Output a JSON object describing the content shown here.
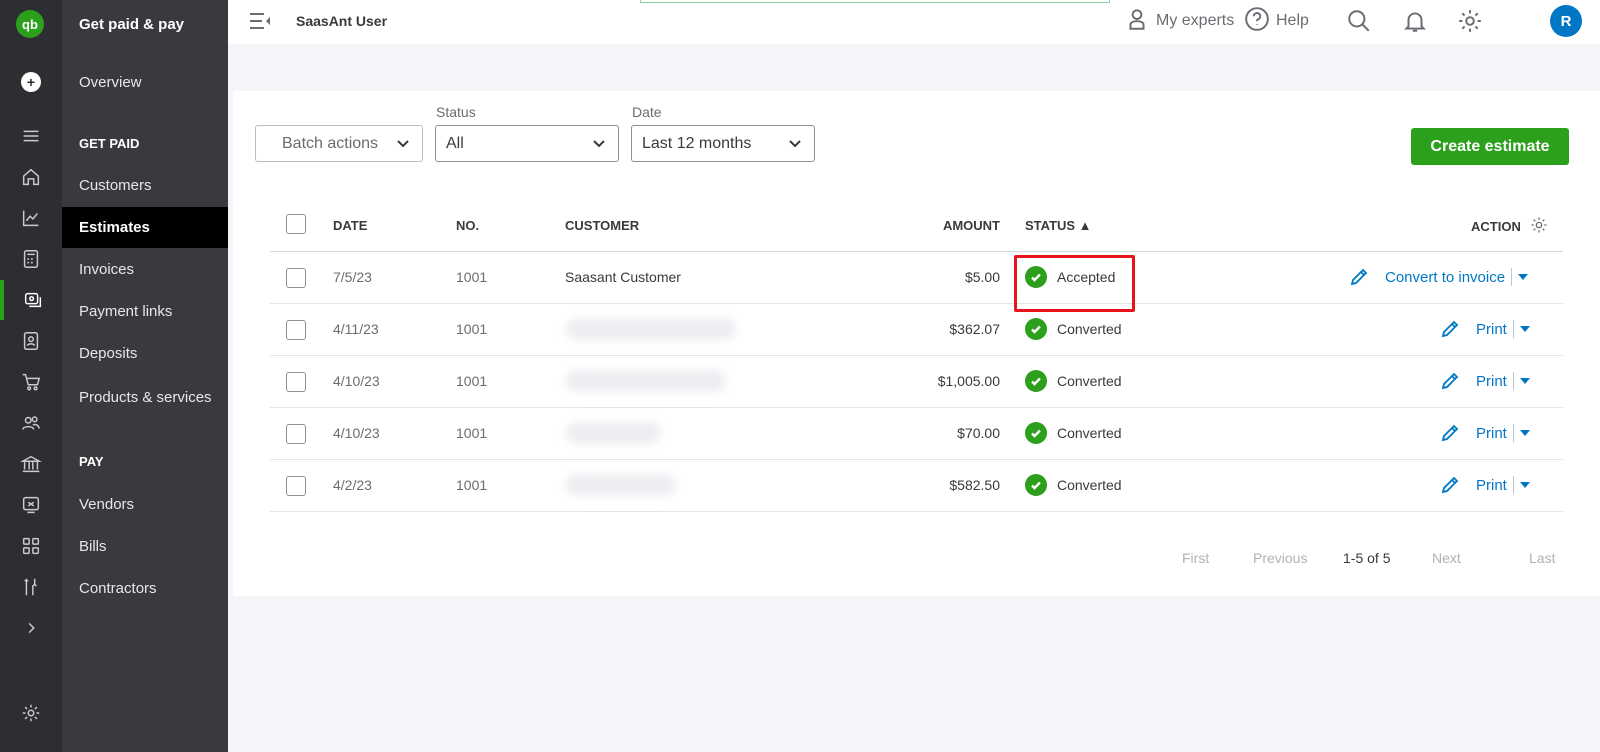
{
  "rail": {
    "logo": "qb",
    "new": "+",
    "icons": [
      "menu-icon",
      "home-icon",
      "chart-icon",
      "calculator-icon",
      "billing-icon",
      "contacts-icon",
      "cart-icon",
      "people-icon",
      "bank-icon",
      "receipt-icon",
      "apps-icon",
      "tools-icon",
      "chevron-right-icon",
      "settings-icon"
    ]
  },
  "nav": {
    "title": "Get paid & pay",
    "overview": "Overview",
    "get_paid_heading": "GET PAID",
    "get_paid": [
      "Customers",
      "Estimates",
      "Invoices",
      "Payment links",
      "Deposits",
      "Products & services"
    ],
    "pay_heading": "PAY",
    "pay": [
      "Vendors",
      "Bills",
      "Contractors"
    ]
  },
  "topbar": {
    "user": "SaasAnt User",
    "my_experts": "My experts",
    "help": "Help",
    "avatar": "R"
  },
  "filters": {
    "batch_actions": "Batch actions",
    "status_label": "Status",
    "status_value": "All",
    "date_label": "Date",
    "date_value": "Last 12 months",
    "create": "Create estimate"
  },
  "table": {
    "headers": {
      "date": "DATE",
      "no": "NO.",
      "customer": "CUSTOMER",
      "amount": "AMOUNT",
      "status": "STATUS ▲",
      "action": "ACTION"
    },
    "rows": [
      {
        "date": "7/5/23",
        "no": "1001",
        "customer": "Saasant Customer",
        "amount": "$5.00",
        "status": "Accepted",
        "action": "Convert to invoice"
      },
      {
        "date": "4/11/23",
        "no": "1001",
        "customer": "",
        "amount": "$362.07",
        "status": "Converted",
        "action": "Print"
      },
      {
        "date": "4/10/23",
        "no": "1001",
        "customer": "",
        "amount": "$1,005.00",
        "status": "Converted",
        "action": "Print"
      },
      {
        "date": "4/10/23",
        "no": "1001",
        "customer": "",
        "amount": "$70.00",
        "status": "Converted",
        "action": "Print"
      },
      {
        "date": "4/2/23",
        "no": "1001",
        "customer": "",
        "amount": "$582.50",
        "status": "Converted",
        "action": "Print"
      }
    ]
  },
  "pager": {
    "first": "First",
    "previous": "Previous",
    "range": "1-5 of 5",
    "next": "Next",
    "last": "Last"
  },
  "colors": {
    "brand_green": "#2ca01c",
    "link_blue": "#0077c5",
    "highlight_red": "#e8141b"
  }
}
